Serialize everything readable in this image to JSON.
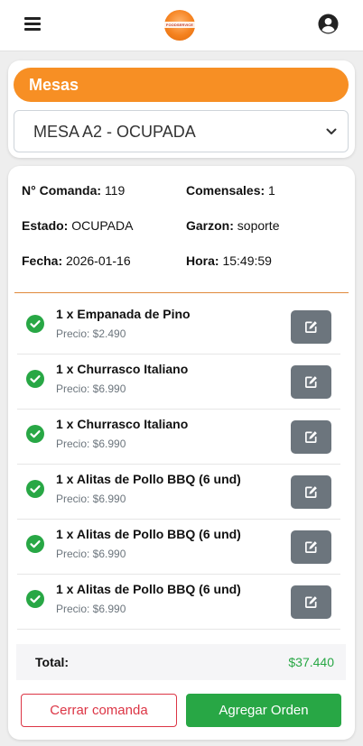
{
  "header": {
    "logo_text": "FOODSERVICE"
  },
  "mesas": {
    "title": "Mesas",
    "selected": "MESA A2 - OCUPADA"
  },
  "comanda": {
    "numero_label": "N° Comanda:",
    "numero": "119",
    "comensales_label": "Comensales:",
    "comensales": "1",
    "estado_label": "Estado:",
    "estado": "OCUPADA",
    "garzon_label": "Garzon:",
    "garzon": "soporte",
    "fecha_label": "Fecha:",
    "fecha": "2026-01-16",
    "hora_label": "Hora:",
    "hora": "15:49:59"
  },
  "items": [
    {
      "name": "1 x Empanada de Pino",
      "price": "Precio: $2.490"
    },
    {
      "name": "1 x Churrasco Italiano",
      "price": "Precio: $6.990"
    },
    {
      "name": "1 x Churrasco Italiano",
      "price": "Precio: $6.990"
    },
    {
      "name": "1 x Alitas de Pollo BBQ (6 und)",
      "price": "Precio: $6.990"
    },
    {
      "name": "1 x Alitas de Pollo BBQ (6 und)",
      "price": "Precio: $6.990"
    },
    {
      "name": "1 x Alitas de Pollo BBQ (6 und)",
      "price": "Precio: $6.990"
    }
  ],
  "total": {
    "label": "Total:",
    "value": "$37.440"
  },
  "actions": {
    "cerrar": "Cerrar comanda",
    "agregar": "Agregar Orden"
  },
  "colors": {
    "accent_orange": "#f78f24",
    "success_green": "#28a745",
    "danger_red": "#dc3545",
    "edit_gray": "#6c757d"
  },
  "icons": {
    "menu": "hamburger-icon",
    "user": "user-circle-icon",
    "item_status": "check-circle-icon",
    "item_edit": "edit-icon",
    "select": "chevron-down-icon"
  }
}
